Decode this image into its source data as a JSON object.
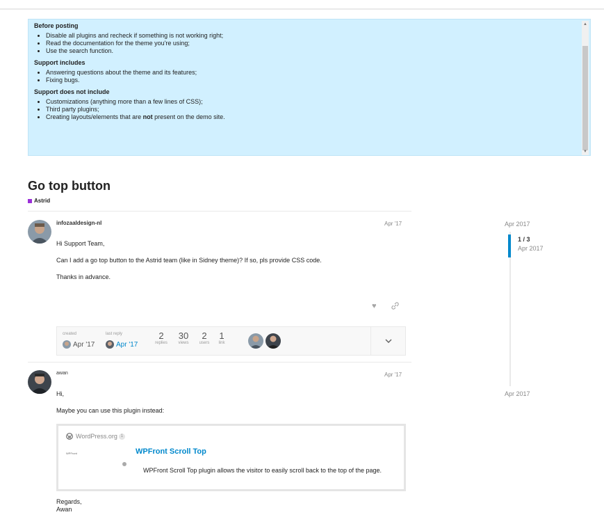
{
  "notice": {
    "sections": [
      {
        "heading": "Before posting",
        "items": [
          "Disable all plugins and recheck if something is not working right;",
          "Read the documentation for the theme you're using;",
          "Use the search function."
        ]
      },
      {
        "heading": "Support includes",
        "items": [
          "Answering questions about the theme and its features;",
          "Fixing bugs."
        ]
      },
      {
        "heading": "Support does not include",
        "items": [
          "Customizations (anything more than a few lines of CSS);",
          "Third party plugins;"
        ]
      }
    ],
    "last_item": {
      "before": "Creating layouts/elements that are ",
      "bold": "not",
      "after": " present on the demo site."
    }
  },
  "topic": {
    "title": "Go top button",
    "category": "Astrid",
    "category_color": "#9b2fd8"
  },
  "posts": [
    {
      "username": "infozaaldesign-nl",
      "date": "Apr '17",
      "paragraphs": [
        "Hi Support Team,",
        "Can I add a go top button to the Astrid team (like in Sidney theme)? If so, pls provide CSS code.",
        "Thanks in advance."
      ]
    },
    {
      "username": "awan",
      "date": "Apr '17",
      "greeting": "Hi,",
      "intro": "Maybe you can use this plugin instead:",
      "signoff_1": "Regards,",
      "signoff_2": "Awan"
    }
  ],
  "icons": {
    "like": "heart-icon",
    "share": "link-icon",
    "expand": "chevron-down-icon",
    "source": "wordpress-icon",
    "scroll_up": "triangle-up-icon",
    "scroll_down": "triangle-down-icon"
  },
  "topic_map": {
    "created_label": "created",
    "created_date": "Apr '17",
    "last_reply_label": "last reply",
    "last_reply_date": "Apr '17",
    "stats": [
      {
        "num": "2",
        "label": "replies"
      },
      {
        "num": "30",
        "label": "views"
      },
      {
        "num": "2",
        "label": "users"
      },
      {
        "num": "1",
        "label": "link"
      }
    ]
  },
  "onebox": {
    "source": "WordPress.org",
    "count": "1",
    "thumb_text": "WPFront",
    "title": "WPFront Scroll Top",
    "description": "WPFront Scroll Top plugin allows the visitor to easily scroll back to the top of the page."
  },
  "timeline": {
    "start": "Apr 2017",
    "position": "1 / 3",
    "position_date": "Apr 2017",
    "end": "Apr 2017"
  }
}
